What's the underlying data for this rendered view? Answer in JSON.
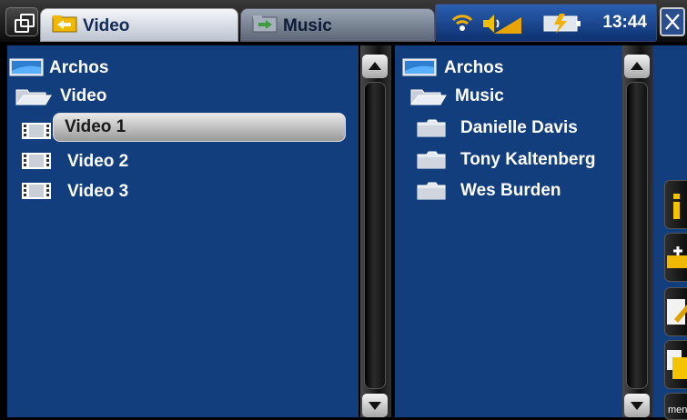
{
  "tabs": [
    {
      "label": "Video",
      "icon": "folder-arrow-icon",
      "active": true
    },
    {
      "label": "Music",
      "icon": "folder-arrow-icon",
      "active": false
    }
  ],
  "status": {
    "time": "13:44",
    "icons": [
      "wifi-icon",
      "volume-icon",
      "battery-charging-icon"
    ]
  },
  "left_pane": {
    "root": "Archos",
    "folder": "Video",
    "items": [
      "Video 1",
      "Video 2",
      "Video 3"
    ],
    "selected": "Video 1"
  },
  "right_pane": {
    "root": "Archos",
    "folder": "Music",
    "items": [
      "Danielle Davis",
      "Tony Kaltenberg",
      "Wes Burden"
    ]
  },
  "sidebar": {
    "buttons": [
      "info-icon",
      "add-folder-icon",
      "edit-icon",
      "copy-icon"
    ],
    "menu_label": "men"
  },
  "colors": {
    "pane": "#123e7e",
    "accent": "#f5c400"
  }
}
